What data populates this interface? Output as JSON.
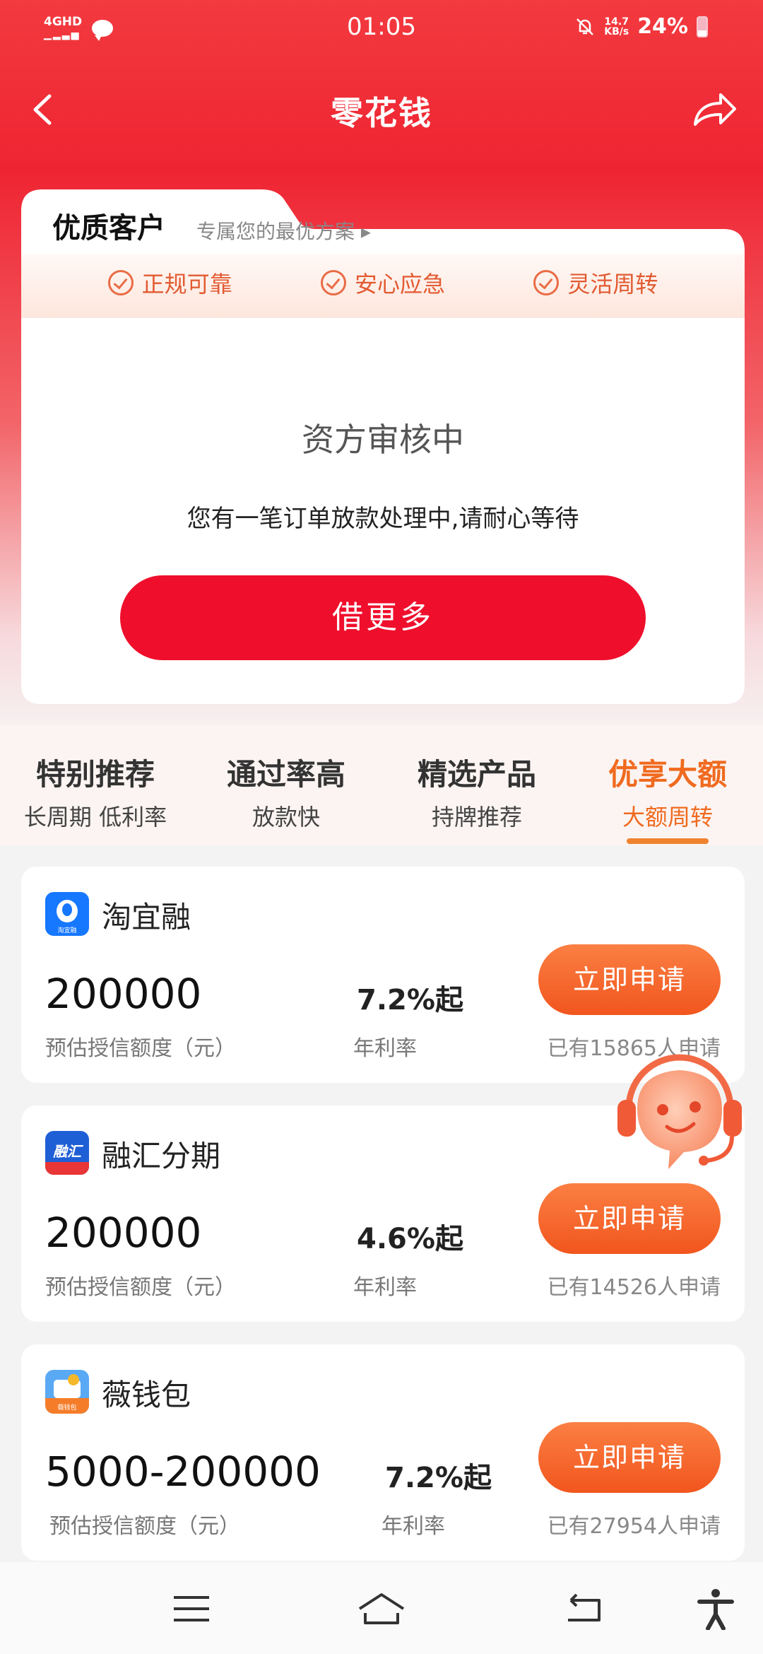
{
  "status_bar": {
    "network": "4GHD",
    "time": "01:05",
    "speed_value": "14.7",
    "speed_unit": "KB/s",
    "battery": "24%"
  },
  "header": {
    "title": "零花钱"
  },
  "vip_card": {
    "title": "优质客户",
    "subtitle": "专属您的最优方案 ▸",
    "features": [
      "正规可靠",
      "安心应急",
      "灵活周转"
    ],
    "status_title": "资方审核中",
    "status_desc": "您有一笔订单放款处理中,请耐心等待",
    "borrow_button": "借更多"
  },
  "categories": [
    {
      "name": "特别推荐",
      "desc": "长周期 低利率"
    },
    {
      "name": "通过率高",
      "desc": "放款快"
    },
    {
      "name": "精选产品",
      "desc": "持牌推荐"
    },
    {
      "name": "优享大额",
      "desc": "大额周转",
      "active": true
    }
  ],
  "products": [
    {
      "name": "淘宜融",
      "logo_text": "淘宜融",
      "amount": "200000",
      "amount_label": "预估授信额度（元）",
      "rate": "7.2%起",
      "rate_label": "年利率",
      "apply_label": "立即申请",
      "count": "已有15865人申请"
    },
    {
      "name": "融汇分期",
      "logo_text": "融汇",
      "amount": "200000",
      "amount_label": "预估授信额度（元）",
      "rate": "4.6%起",
      "rate_label": "年利率",
      "apply_label": "立即申请",
      "count": "已有14526人申请"
    },
    {
      "name": "薇钱包",
      "logo_text": "薇钱包",
      "amount": "5000-200000",
      "amount_label": "预估授信额度（元）",
      "rate": "7.2%起",
      "rate_label": "年利率",
      "apply_label": "立即申请",
      "count": "已有27954人申请"
    }
  ],
  "colors": {
    "primary_red": "#ef0f2c",
    "accent_orange": "#f06a1f",
    "feature_orange": "#e25a31"
  }
}
